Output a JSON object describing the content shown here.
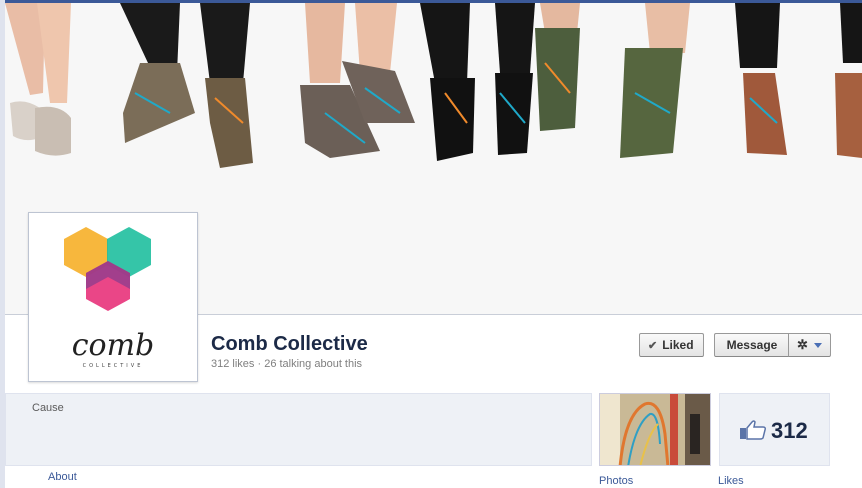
{
  "page": {
    "name": "Comb Collective",
    "likes_count_text": "312 likes",
    "talking_text": "26 talking about this",
    "separator": " · "
  },
  "logo": {
    "wordmark": "comb",
    "subword": "COLLECTIVE",
    "colors": {
      "orange": "#f6b12c",
      "teal": "#1fbf9e",
      "pink": "#e8327a",
      "purple": "#8a3e8e"
    }
  },
  "actions": {
    "liked_label": "Liked",
    "message_label": "Message",
    "gear_icon": "gear-icon",
    "dropdown_icon": "chevron-down-icon"
  },
  "info": {
    "category": "Cause",
    "about_link": "About"
  },
  "apps": {
    "photos_label": "Photos",
    "likes_value": "312",
    "likes_label": "Likes"
  },
  "colors": {
    "brand_blue": "#3b5998",
    "name_text": "#1c2a47",
    "panel_bg": "#eef1f6"
  }
}
